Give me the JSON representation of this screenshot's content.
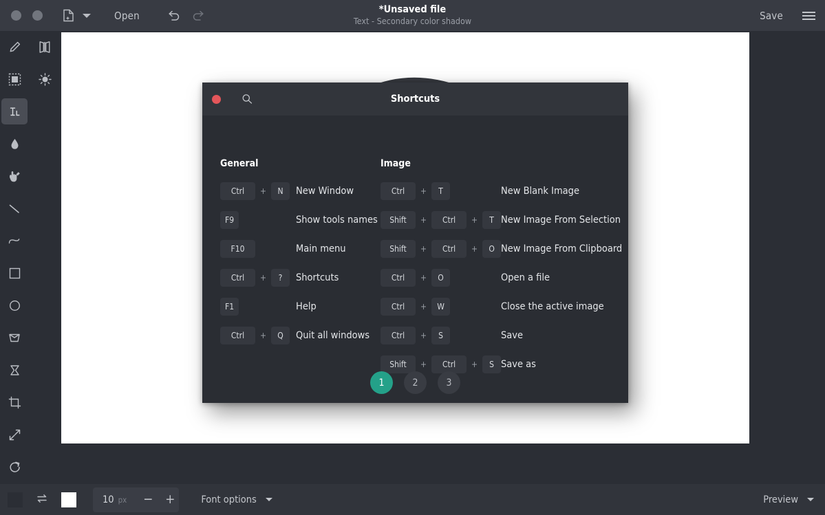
{
  "topbar": {
    "open_label": "Open",
    "save_label": "Save",
    "icons": {
      "window_dot_1": "window-dot",
      "window_dot_2": "window-dot",
      "new_file": "new-file-icon",
      "dropdown": "chevron-down-icon",
      "undo": "undo-icon",
      "redo": "redo-icon",
      "menu": "hamburger-icon"
    }
  },
  "title": {
    "main": "*Unsaved file",
    "subtitle": "Text - Secondary color shadow"
  },
  "tools": [
    {
      "name": "pencil-tool",
      "icon": "pencil-icon",
      "selected": false
    },
    {
      "name": "mirror-tool",
      "icon": "mirror-icon",
      "selected": false
    },
    {
      "name": "selection-tool",
      "icon": "rect-select-icon",
      "selected": false
    },
    {
      "name": "brightness-tool",
      "icon": "sun-icon",
      "selected": false
    },
    {
      "name": "text-tool",
      "icon": "text-cursor-icon",
      "selected": true
    },
    {
      "name": "fill-tool",
      "icon": "droplet-icon",
      "selected": false
    },
    {
      "name": "color-picker-tool",
      "icon": "hand-picker-icon",
      "selected": false
    },
    {
      "name": "line-tool",
      "icon": "line-icon",
      "selected": false
    },
    {
      "name": "curve-tool",
      "icon": "curve-icon",
      "selected": false
    },
    {
      "name": "rectangle-tool",
      "icon": "square-icon",
      "selected": false
    },
    {
      "name": "ellipse-tool",
      "icon": "circle-icon",
      "selected": false
    },
    {
      "name": "perspective-tool",
      "icon": "perspective-icon",
      "selected": false
    },
    {
      "name": "distort-tool",
      "icon": "hourglass-icon",
      "selected": false
    },
    {
      "name": "crop-tool",
      "icon": "crop-icon",
      "selected": false
    },
    {
      "name": "scale-tool",
      "icon": "resize-arrows-icon",
      "selected": false
    },
    {
      "name": "rotate-tool",
      "icon": "rotate-icon",
      "selected": false
    }
  ],
  "bottombar": {
    "primary_color": "#2b2e35",
    "secondary_color": "#ffffff",
    "swap_icon": "swap-colors-icon",
    "size_value": "10",
    "size_unit": "px",
    "minus_label": "−",
    "plus_label": "+",
    "font_options_label": "Font options",
    "preview_label": "Preview"
  },
  "dialog": {
    "title": "Shortcuts",
    "close_icon": "close-icon",
    "search_icon": "search-icon",
    "accent_color": "#24a189",
    "columns": [
      {
        "heading": "General",
        "rows": [
          {
            "keys": [
              "Ctrl",
              "N"
            ],
            "desc": "New Window"
          },
          {
            "keys": [
              "F9"
            ],
            "desc": "Show tools names"
          },
          {
            "keys": [
              "F10"
            ],
            "desc": "Main menu"
          },
          {
            "keys": [
              "Ctrl",
              "?"
            ],
            "desc": "Shortcuts"
          },
          {
            "keys": [
              "F1"
            ],
            "desc": "Help"
          },
          {
            "keys": [
              "Ctrl",
              "Q"
            ],
            "desc": "Quit all windows"
          }
        ]
      },
      {
        "heading": "Image",
        "rows": [
          {
            "keys": [
              "Ctrl",
              "T"
            ],
            "desc": "New Blank Image"
          },
          {
            "keys": [
              "Shift",
              "Ctrl",
              "T"
            ],
            "desc": "New Image From Selection"
          },
          {
            "keys": [
              "Shift",
              "Ctrl",
              "O"
            ],
            "desc": "New Image From Clipboard"
          },
          {
            "keys": [
              "Ctrl",
              "O"
            ],
            "desc": "Open a file"
          },
          {
            "keys": [
              "Ctrl",
              "W"
            ],
            "desc": "Close the active image"
          },
          {
            "keys": [
              "Ctrl",
              "S"
            ],
            "desc": "Save"
          },
          {
            "keys": [
              "Shift",
              "Ctrl",
              "S"
            ],
            "desc": "Save as"
          }
        ]
      }
    ],
    "pages": [
      {
        "label": "1",
        "active": true
      },
      {
        "label": "2",
        "active": false
      },
      {
        "label": "3",
        "active": false
      }
    ]
  }
}
